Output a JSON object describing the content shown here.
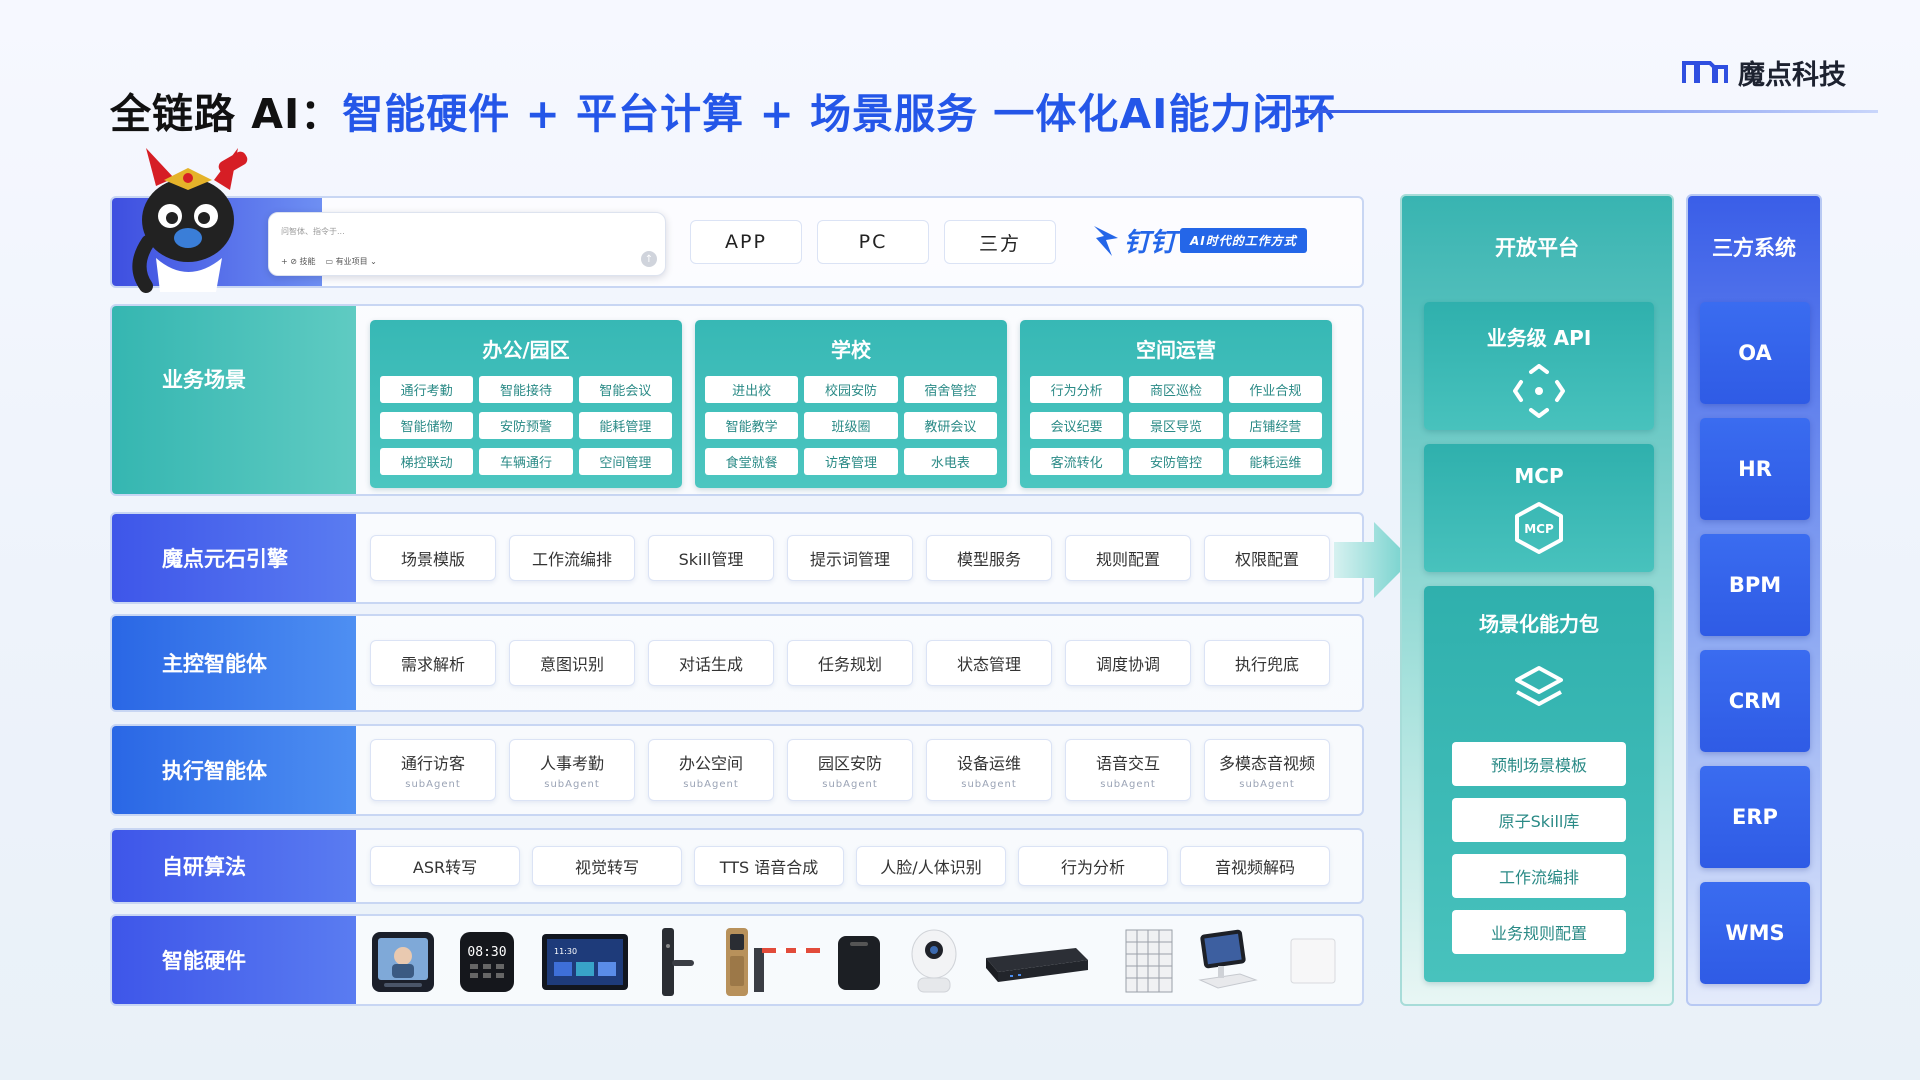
{
  "header": {
    "title_prefix": "全链路 AI：",
    "title_highlight": "智能硬件 + 平台计算 + 场景服务",
    "title_suffix": " 一体化AI能力闭环",
    "logo_text": "魔点科技"
  },
  "top_row": {
    "chat_placeholder": "问智体、指令于...",
    "chat_tool_1": "+ ⊘ 技能",
    "chat_tool_2": "▭ 有业项目 ⌄",
    "channels": [
      "APP",
      "PC",
      "三方"
    ],
    "dingtalk_name": "钉钉",
    "dingtalk_slogan": "AI时代的工作方式"
  },
  "business": {
    "label": "业务场景",
    "groups": [
      {
        "title": "办公/园区",
        "items": [
          "通行考勤",
          "智能接待",
          "智能会议",
          "智能储物",
          "安防预警",
          "能耗管理",
          "梯控联动",
          "车辆通行",
          "空间管理"
        ]
      },
      {
        "title": "学校",
        "items": [
          "进出校",
          "校园安防",
          "宿舍管控",
          "智能教学",
          "班级圈",
          "教研会议",
          "食堂就餐",
          "访客管理",
          "水电表"
        ]
      },
      {
        "title": "空间运营",
        "items": [
          "行为分析",
          "商区巡检",
          "作业合规",
          "会议纪要",
          "景区导览",
          "店铺经营",
          "客流转化",
          "安防管控",
          "能耗运维"
        ]
      }
    ]
  },
  "engine": {
    "label": "魔点元石引擎",
    "items": [
      "场景模版",
      "工作流编排",
      "Skill管理",
      "提示词管理",
      "模型服务",
      "规则配置",
      "权限配置"
    ]
  },
  "master_agent": {
    "label": "主控智能体",
    "items": [
      "需求解析",
      "意图识别",
      "对话生成",
      "任务规划",
      "状态管理",
      "调度协调",
      "执行兜底"
    ]
  },
  "exec_agent": {
    "label": "执行智能体",
    "sub": "subAgent",
    "items": [
      "通行访客",
      "人事考勤",
      "办公空间",
      "园区安防",
      "设备运维",
      "语音交互",
      "多模态音视频"
    ]
  },
  "algorithm": {
    "label": "自研算法",
    "items": [
      "ASR转写",
      "视觉转写",
      "TTS 语音合成",
      "人脸/人体识别",
      "行为分析",
      "音视频解码"
    ]
  },
  "hardware": {
    "label": "智能硬件",
    "devices": [
      "face-terminal-icon",
      "attendance-clock-icon",
      "smart-display-icon",
      "smart-lock-icon",
      "access-reader-icon",
      "barrier-gate-icon",
      "storage-box-icon",
      "ptz-camera-icon",
      "edge-server-icon",
      "locker-cabinet-icon",
      "pos-terminal-icon",
      "wall-panel-icon"
    ]
  },
  "open_platform": {
    "title": "开放平台",
    "api_title": "业务级 API",
    "mcp_title": "MCP",
    "mcp_badge": "MCP",
    "pack_title": "场景化能力包",
    "pack_items": [
      "预制场景模板",
      "原子Skill库",
      "工作流编排",
      "业务规则配置"
    ]
  },
  "third_party": {
    "title": "三方系统",
    "systems": [
      "OA",
      "HR",
      "BPM",
      "CRM",
      "ERP",
      "WMS"
    ]
  },
  "colors": {
    "accent_blue": "#2456e8",
    "teal": "#37b8b5",
    "indigo": "#3e56e9"
  }
}
